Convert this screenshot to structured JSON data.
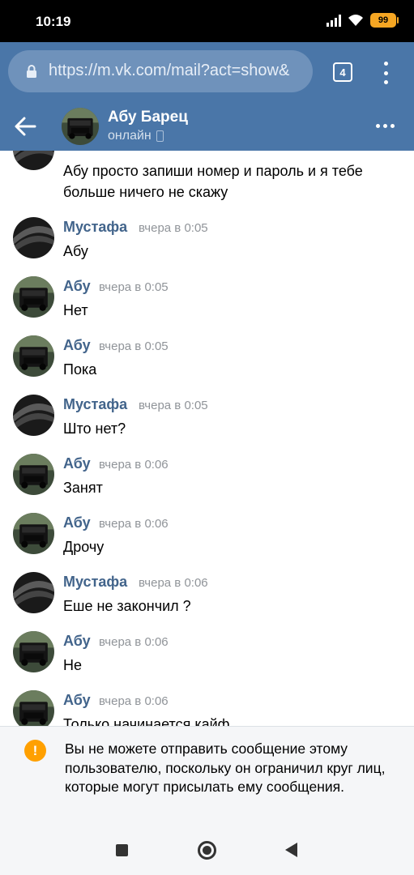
{
  "status_bar": {
    "time": "10:19",
    "battery": "99"
  },
  "browser": {
    "url": "https://m.vk.com/mail?act=show&",
    "tab_count": "4"
  },
  "chat": {
    "name": "Абу Барец",
    "status": "онлайн"
  },
  "partial_message": {
    "text": "Абу просто запиши номер и пароль и я тебе больше ничего не скажу"
  },
  "messages": [
    {
      "author": "Мустафа",
      "time": "вчера в 0:05",
      "text": "Абу"
    },
    {
      "author": "Абу",
      "time": "вчера в 0:05",
      "text": "Нет"
    },
    {
      "author": "Абу",
      "time": "вчера в 0:05",
      "text": "Пока"
    },
    {
      "author": "Мустафа",
      "time": "вчера в 0:05",
      "text": "Што нет?"
    },
    {
      "author": "Абу",
      "time": "вчера в 0:06",
      "text": "Занят"
    },
    {
      "author": "Абу",
      "time": "вчера в 0:06",
      "text": "Дрочу"
    },
    {
      "author": "Мустафа",
      "time": "вчера в 0:06",
      "text": "Еше не закончил ?"
    },
    {
      "author": "Абу",
      "time": "вчера в 0:06",
      "text": "Не"
    },
    {
      "author": "Абу",
      "time": "вчера в 0:06",
      "text": "Только начинается кайф"
    }
  ],
  "notice": {
    "icon": "warning-icon",
    "text": "Вы не можете отправить сообщение этому пользователю, поскольку он ограничил круг лиц, которые могут присылать ему сообщения."
  },
  "colors": {
    "vk_blue": "#4a76a8",
    "name_blue": "#42648b",
    "warning": "#ffa000"
  }
}
